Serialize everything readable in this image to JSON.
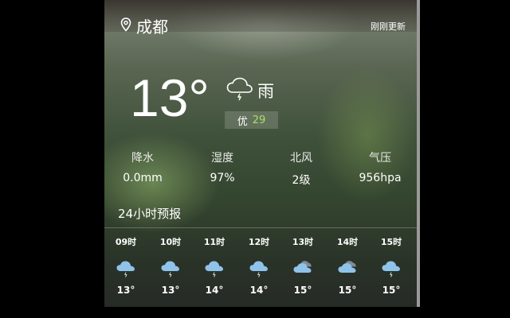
{
  "header": {
    "city": "成都",
    "update_status": "刚刚更新"
  },
  "current": {
    "temperature": "13°",
    "condition": "雨",
    "aqi_label": "优",
    "aqi_value": "29"
  },
  "stats": [
    {
      "label": "降水",
      "value": "0.0mm"
    },
    {
      "label": "湿度",
      "value": "97%"
    },
    {
      "label": "北风",
      "value": "2级"
    },
    {
      "label": "气压",
      "value": "956hpa"
    }
  ],
  "forecast": {
    "title": "24小时预报",
    "hours": [
      {
        "time": "09时",
        "temp": "13°",
        "icon": "rain-cloud-icon"
      },
      {
        "time": "10时",
        "temp": "13°",
        "icon": "rain-cloud-icon"
      },
      {
        "time": "11时",
        "temp": "14°",
        "icon": "rain-cloud-icon"
      },
      {
        "time": "12时",
        "temp": "14°",
        "icon": "rain-cloud-icon"
      },
      {
        "time": "13时",
        "temp": "15°",
        "icon": "partly-cloudy-icon"
      },
      {
        "time": "14时",
        "temp": "15°",
        "icon": "partly-cloudy-icon"
      },
      {
        "time": "15时",
        "temp": "15°",
        "icon": "rain-cloud-icon"
      }
    ]
  },
  "colors": {
    "aqi_good": "#a9e163",
    "weather_icon": "#8fc3ea"
  }
}
